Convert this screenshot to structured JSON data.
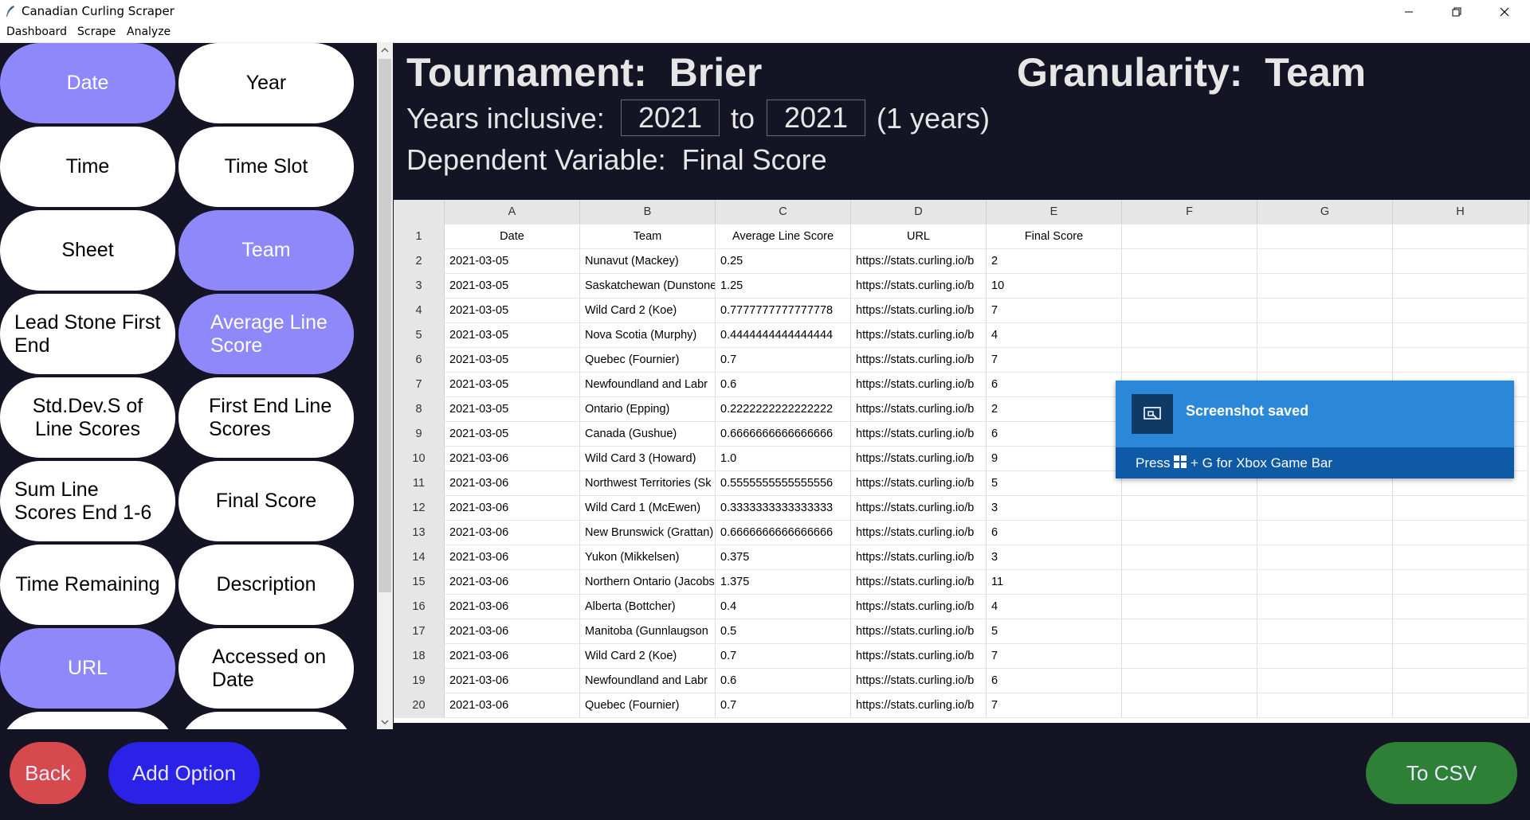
{
  "window": {
    "title": "Canadian Curling Scraper"
  },
  "menu": [
    "Dashboard",
    "Scrape",
    "Analyze"
  ],
  "options": [
    {
      "label": "Date",
      "selected": true
    },
    {
      "label": "Year",
      "selected": false
    },
    {
      "label": "Time",
      "selected": false
    },
    {
      "label": "Time Slot",
      "selected": false
    },
    {
      "label": "Sheet",
      "selected": false
    },
    {
      "label": "Team",
      "selected": true
    },
    {
      "label": "Lead Stone First End",
      "selected": false
    },
    {
      "label": "Average Line Score",
      "selected": true
    },
    {
      "label": "Std.Dev.S of Line Scores",
      "selected": false
    },
    {
      "label": "First End Line Scores",
      "selected": false
    },
    {
      "label": "Sum Line Scores End 1-6",
      "selected": false
    },
    {
      "label": "Final Score",
      "selected": false
    },
    {
      "label": "Time Remaining",
      "selected": false
    },
    {
      "label": "Description",
      "selected": false
    },
    {
      "label": "URL",
      "selected": true
    },
    {
      "label": "Accessed on Date",
      "selected": false
    }
  ],
  "header": {
    "tournament_label": "Tournament:",
    "tournament": "Brier",
    "granularity_label": "Granularity:",
    "granularity": "Team",
    "years_label": "Years inclusive:",
    "year_from": "2021",
    "to_label": "to",
    "year_to": "2021",
    "years_count": "(1 years)",
    "dependent_label": "Dependent Variable:",
    "dependent": "Final Score"
  },
  "sheet": {
    "columns": [
      "A",
      "B",
      "C",
      "D",
      "E",
      "F",
      "G",
      "H"
    ],
    "headers": [
      "Date",
      "Team",
      "Average Line Score",
      "URL",
      "Final Score",
      "",
      "",
      ""
    ],
    "rows": [
      [
        "2021-03-05",
        "Nunavut (Mackey)",
        "0.25",
        "https://stats.curling.io/b",
        "2"
      ],
      [
        "2021-03-05",
        "Saskatchewan (Dunstone",
        "1.25",
        "https://stats.curling.io/b",
        "10"
      ],
      [
        "2021-03-05",
        "Wild Card 2 (Koe)",
        "0.7777777777777778",
        "https://stats.curling.io/b",
        "7"
      ],
      [
        "2021-03-05",
        "Nova Scotia (Murphy)",
        "0.4444444444444444",
        "https://stats.curling.io/b",
        "4"
      ],
      [
        "2021-03-05",
        "Quebec (Fournier)",
        "0.7",
        "https://stats.curling.io/b",
        "7"
      ],
      [
        "2021-03-05",
        "Newfoundland and Labr",
        "0.6",
        "https://stats.curling.io/b",
        "6"
      ],
      [
        "2021-03-05",
        "Ontario (Epping)",
        "0.2222222222222222",
        "https://stats.curling.io/b",
        "2"
      ],
      [
        "2021-03-05",
        "Canada (Gushue)",
        "0.6666666666666666",
        "https://stats.curling.io/b",
        "6"
      ],
      [
        "2021-03-06",
        "Wild Card 3 (Howard)",
        "1.0",
        "https://stats.curling.io/b",
        "9"
      ],
      [
        "2021-03-06",
        "Northwest Territories (Sk",
        "0.5555555555555556",
        "https://stats.curling.io/b",
        "5"
      ],
      [
        "2021-03-06",
        "Wild Card 1 (McEwen)",
        "0.3333333333333333",
        "https://stats.curling.io/b",
        "3"
      ],
      [
        "2021-03-06",
        "New Brunswick (Grattan)",
        "0.6666666666666666",
        "https://stats.curling.io/b",
        "6"
      ],
      [
        "2021-03-06",
        "Yukon (Mikkelsen)",
        "0.375",
        "https://stats.curling.io/b",
        "3"
      ],
      [
        "2021-03-06",
        "Northern Ontario (Jacobs",
        "1.375",
        "https://stats.curling.io/b",
        "11"
      ],
      [
        "2021-03-06",
        "Alberta (Bottcher)",
        "0.4",
        "https://stats.curling.io/b",
        "4"
      ],
      [
        "2021-03-06",
        "Manitoba (Gunnlaugson",
        "0.5",
        "https://stats.curling.io/b",
        "5"
      ],
      [
        "2021-03-06",
        "Wild Card 2 (Koe)",
        "0.7",
        "https://stats.curling.io/b",
        "7"
      ],
      [
        "2021-03-06",
        "Newfoundland and Labr",
        "0.6",
        "https://stats.curling.io/b",
        "6"
      ],
      [
        "2021-03-06",
        "Quebec (Fournier)",
        "0.7",
        "https://stats.curling.io/b",
        "7"
      ]
    ]
  },
  "toast": {
    "title": "Screenshot saved",
    "press": "Press",
    "message": "+ G for Xbox Game Bar"
  },
  "buttons": {
    "back": "Back",
    "add_option": "Add Option",
    "to_csv": "To CSV"
  },
  "colors": {
    "background": "#141424",
    "selected": "#8f88fa",
    "back": "#d64a4d",
    "add": "#2a22e6",
    "csv": "#2e8036"
  }
}
